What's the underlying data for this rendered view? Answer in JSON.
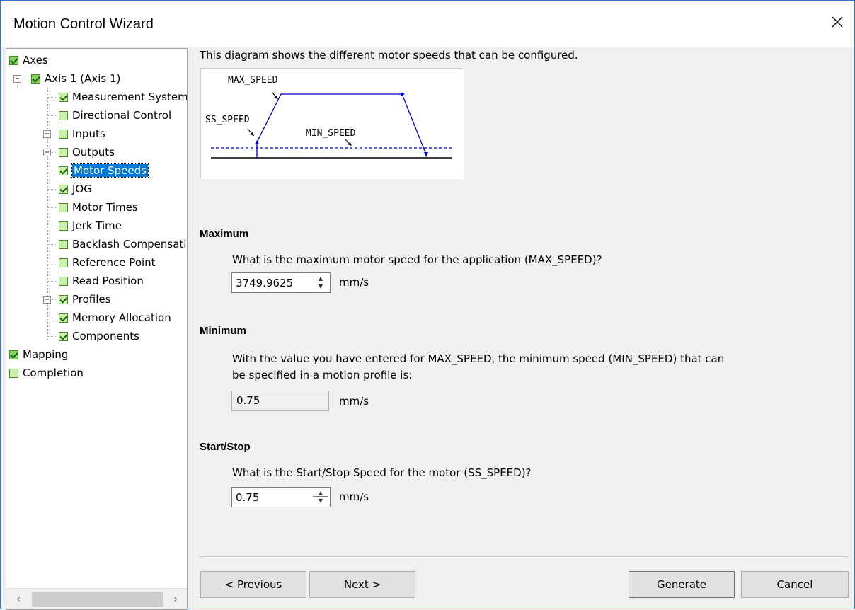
{
  "window": {
    "title": "Motion Control Wizard"
  },
  "tree": {
    "items": [
      {
        "label": "Axes",
        "checked": true
      },
      {
        "label": "Axis 1 (Axis 1)",
        "checked": true
      },
      {
        "label": "Measurement System",
        "checked": true
      },
      {
        "label": "Directional Control",
        "checked": false
      },
      {
        "label": "Inputs",
        "checked": false
      },
      {
        "label": "Outputs",
        "checked": false
      },
      {
        "label": "Motor Speeds",
        "checked": true,
        "selected": true
      },
      {
        "label": "JOG",
        "checked": true
      },
      {
        "label": "Motor Times",
        "checked": false
      },
      {
        "label": "Jerk Time",
        "checked": false
      },
      {
        "label": "Backlash Compensation",
        "checked": false
      },
      {
        "label": "Reference Point",
        "checked": false
      },
      {
        "label": "Read Position",
        "checked": false
      },
      {
        "label": "Profiles",
        "checked": true
      },
      {
        "label": "Memory Allocation",
        "checked": true
      },
      {
        "label": "Components",
        "checked": true
      },
      {
        "label": "Mapping",
        "checked": true
      },
      {
        "label": "Completion",
        "checked": false
      }
    ]
  },
  "intro_text": "This diagram shows the different motor speeds that can be configured.",
  "diagram": {
    "max_label": "MAX_SPEED",
    "ss_label": "SS_SPEED",
    "min_label": "MIN_SPEED"
  },
  "maximum": {
    "heading": "Maximum",
    "question": "What is the maximum motor speed for the application (MAX_SPEED)?",
    "value": "3749.9625",
    "unit": "mm/s"
  },
  "minimum": {
    "heading": "Minimum",
    "question_line1": "With the value you have entered for MAX_SPEED, the minimum speed (MIN_SPEED) that can",
    "question_line2": "be specified in a motion profile is:",
    "value": "0.75",
    "unit": "mm/s"
  },
  "startstop": {
    "heading": "Start/Stop",
    "question": "What is the Start/Stop Speed for the motor (SS_SPEED)?",
    "value": "0.75",
    "unit": "mm/s"
  },
  "buttons": {
    "previous": "< Previous",
    "next": "Next >",
    "generate": "Generate",
    "cancel": "Cancel"
  },
  "colors": {
    "selection": "#0078d7",
    "diagram_line": "#0000cc",
    "window_border": "#2b79d6"
  }
}
